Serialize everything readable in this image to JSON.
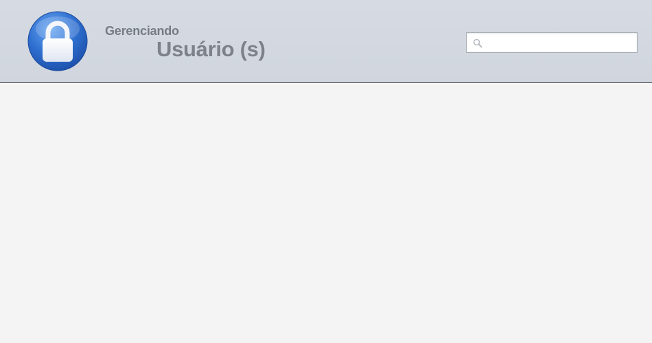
{
  "header": {
    "icon": "lock-icon",
    "subtitle": "Gerenciando",
    "title": "Usuário (s)"
  },
  "search": {
    "icon": "search-icon",
    "value": "",
    "placeholder": ""
  },
  "colors": {
    "header_bg": "#d3d8e0",
    "content_bg": "#f4f4f4",
    "badge_blue": "#2f6fd0",
    "title_text": "#7d8289"
  }
}
